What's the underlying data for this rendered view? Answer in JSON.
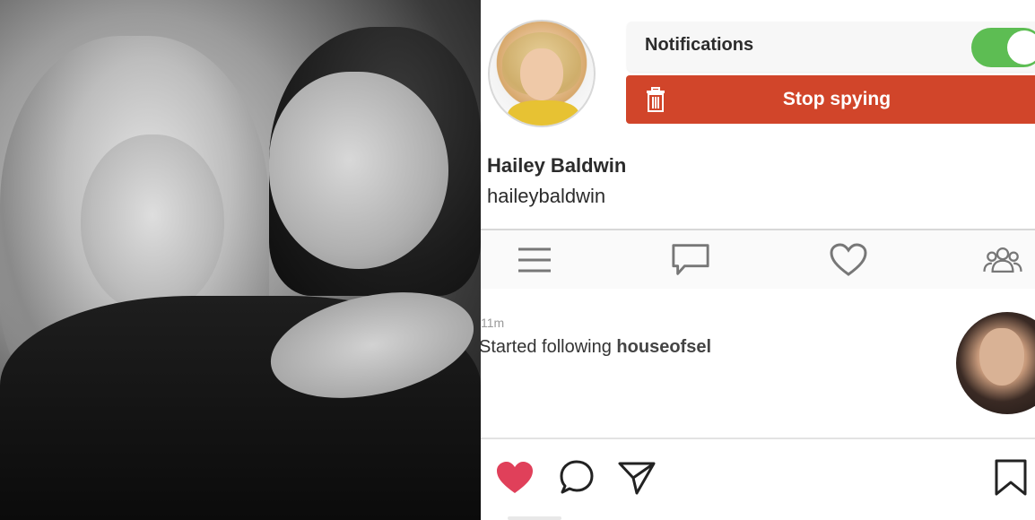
{
  "photo": {
    "icon": "photo-two-people-bw"
  },
  "profile": {
    "display_name": "Hailey Baldwin",
    "username": "haileybaldwin"
  },
  "notifications": {
    "label": "Notifications",
    "enabled": true
  },
  "stop_button": {
    "label": "Stop spying",
    "icon": "trash-icon"
  },
  "tabs": [
    {
      "name": "menu-icon"
    },
    {
      "name": "comment-icon"
    },
    {
      "name": "heart-icon"
    },
    {
      "name": "users-icon"
    }
  ],
  "activity": {
    "time": "11m",
    "text_prefix": "Started following ",
    "user": "houseofsel"
  },
  "actions": [
    {
      "name": "like-icon"
    },
    {
      "name": "comment-icon"
    },
    {
      "name": "share-icon"
    },
    {
      "name": "bookmark-icon"
    }
  ],
  "colors": {
    "toggle_on": "#5dbd53",
    "stop_button": "#d1452a",
    "like_heart": "#e0405a"
  }
}
